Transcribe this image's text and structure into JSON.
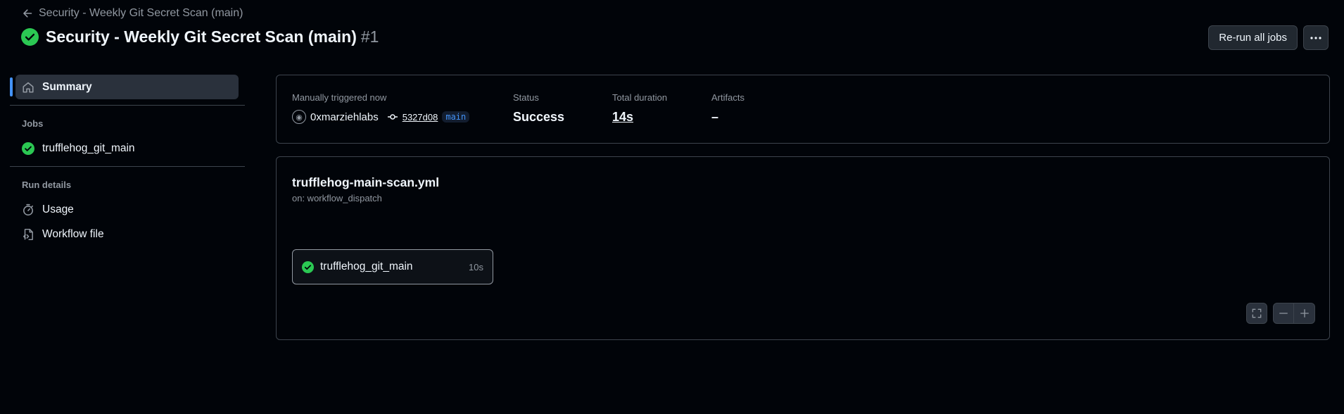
{
  "header": {
    "back_label": "Security - Weekly Git Secret Scan (main)",
    "title": "Security - Weekly Git Secret Scan (main)",
    "run_number": "#1",
    "rerun_label": "Re-run all jobs",
    "more_label": "···"
  },
  "sidebar": {
    "summary_label": "Summary",
    "jobs_heading": "Jobs",
    "jobs": [
      {
        "label": "trufflehog_git_main"
      }
    ],
    "run_details_heading": "Run details",
    "usage_label": "Usage",
    "workflow_file_label": "Workflow file"
  },
  "summary": {
    "trigger_label": "Manually triggered now",
    "actor": "0xmarziehlabs",
    "commit": "5327d08",
    "branch": "main",
    "status_label": "Status",
    "status_value": "Success",
    "duration_label": "Total duration",
    "duration_value": "14s",
    "artifacts_label": "Artifacts",
    "artifacts_value": "–"
  },
  "workflow": {
    "file": "trufflehog-main-scan.yml",
    "trigger": "on: workflow_dispatch",
    "job_name": "trufflehog_git_main",
    "job_time": "10s"
  },
  "colors": {
    "success": "#2bc853",
    "accent": "#4493f8",
    "background": "#010409"
  }
}
